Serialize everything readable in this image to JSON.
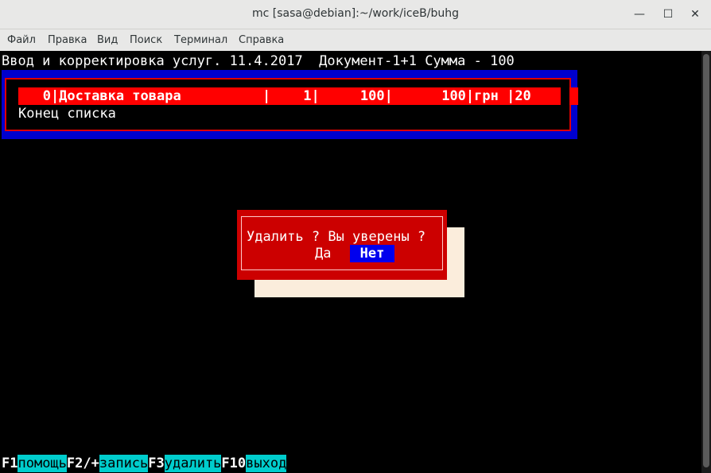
{
  "window": {
    "title": "mc [sasa@debian]:~/work/iceB/buhg",
    "minimize_glyph": "—",
    "maximize_glyph": "☐",
    "close_glyph": "✕"
  },
  "menu": [
    "Файл",
    "Правка",
    "Вид",
    "Поиск",
    "Терминал",
    "Справка"
  ],
  "terminal": {
    "heading": "Ввод и корректировка услуг. 11.4.2017  Документ-1+1 Сумма - 100",
    "row": "   0|Доставка товара          |    1|     100|      100|грн |20",
    "end_of_list": "Конец списка",
    "colors": {
      "list_box": "#0000ce",
      "highlight": "#ff0000",
      "dialog": "#cc0000",
      "fkey_label_bg": "#00cdcd"
    }
  },
  "dialog": {
    "question": "Удалить ? Вы уверены ?",
    "yes": "Да",
    "no": "Нет"
  },
  "fkeys": [
    {
      "key": "F1",
      "label": "помощь"
    },
    {
      "key": "F2/+",
      "label": "запись"
    },
    {
      "key": "F3",
      "label": "удалить"
    },
    {
      "key": "F10",
      "label": "выход"
    }
  ]
}
